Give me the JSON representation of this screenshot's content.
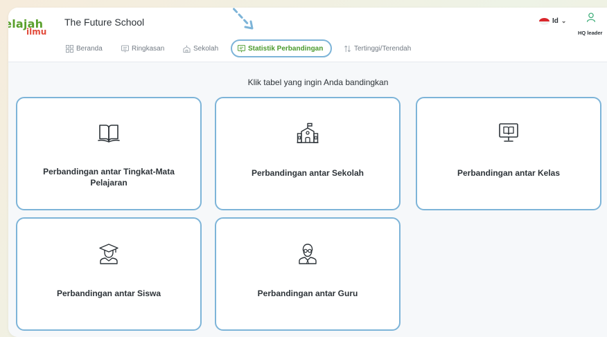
{
  "app": {
    "logo_line1": "Jelajah",
    "logo_line2": "ilmu",
    "school_name": "The Future School"
  },
  "language": {
    "code": "Id"
  },
  "user": {
    "role": "HQ leader"
  },
  "tabs": [
    {
      "label": "Beranda",
      "icon": "grid-icon"
    },
    {
      "label": "Ringkasan",
      "icon": "summary-icon"
    },
    {
      "label": "Sekolah",
      "icon": "school-icon"
    },
    {
      "label": "Statistik Perbandingan",
      "icon": "comparison-icon",
      "active": true
    },
    {
      "label": "Tertinggi/Terendah",
      "icon": "sort-icon"
    }
  ],
  "main": {
    "prompt": "Klik tabel yang ingin Anda bandingkan",
    "cards": [
      {
        "label": "Perbandingan antar Tingkat-Mata Pelajaran",
        "icon": "book-icon"
      },
      {
        "label": "Perbandingan antar Sekolah",
        "icon": "school-building-icon"
      },
      {
        "label": "Perbandingan antar Kelas",
        "icon": "classroom-board-icon"
      },
      {
        "label": "Perbandingan antar Siswa",
        "icon": "graduate-student-icon"
      },
      {
        "label": "Perbandingan antar Guru",
        "icon": "teacher-icon"
      }
    ]
  },
  "colors": {
    "accent_green": "#4a9a2d",
    "card_border": "#7db4d8",
    "logo_green": "#5aa02c",
    "logo_red": "#e24b3b"
  }
}
